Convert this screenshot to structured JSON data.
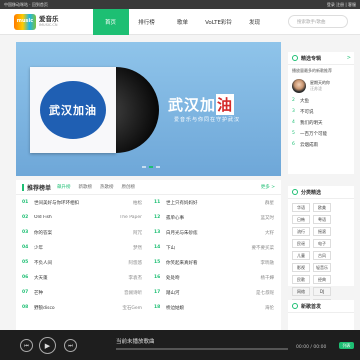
{
  "topbar": {
    "left": "中国移动咪咕 · 回到首页",
    "right": "登录 注册 | 客服"
  },
  "logo": {
    "badge": "music",
    "name": "爱音乐",
    "sub": "IMUSIC.CN"
  },
  "nav": [
    {
      "label": "首页"
    },
    {
      "label": "排行榜"
    },
    {
      "label": "歌单"
    },
    {
      "label": "VoLTE彩铃"
    },
    {
      "label": "发现"
    }
  ],
  "search": {
    "placeholder": "搜索歌手/歌曲"
  },
  "banner": {
    "cover_text": "武汉加油",
    "title": "武汉加",
    "title_box": "油",
    "subtitle": "爱音乐与你同在守护武汉"
  },
  "chart": {
    "title": "推荐榜单",
    "tabs": [
      "飙升榜",
      "新歌榜",
      "热歌榜",
      "原创榜"
    ],
    "more": "更多 >",
    "left": [
      {
        "n": "01",
        "song": "世间美好与你环环相扣",
        "artist": "柏松"
      },
      {
        "n": "02",
        "song": "Old Fish",
        "artist": "The Paper"
      },
      {
        "n": "03",
        "song": "你的答案",
        "artist": "阿冗"
      },
      {
        "n": "04",
        "song": "少年",
        "artist": "梦然"
      },
      {
        "n": "05",
        "song": "不负人间",
        "artist": "阿悠悠"
      },
      {
        "n": "06",
        "song": "大天蓬",
        "artist": "李袁杰"
      },
      {
        "n": "07",
        "song": "芒种",
        "artist": "音阙诗听"
      },
      {
        "n": "08",
        "song": "野狼disco",
        "artist": "宝石Gem"
      }
    ],
    "right": [
      {
        "n": "11",
        "song": "世上只有妈妈好",
        "artist": "群星"
      },
      {
        "n": "12",
        "song": "孤单心事",
        "artist": "蓝又时"
      },
      {
        "n": "13",
        "song": "白月光与朱砂痣",
        "artist": "大籽"
      },
      {
        "n": "14",
        "song": "下山",
        "artist": "要不要买菜"
      },
      {
        "n": "15",
        "song": "你笑起来真好看",
        "artist": "李昕融"
      },
      {
        "n": "16",
        "song": "处处吻",
        "artist": "杨千嬅"
      },
      {
        "n": "17",
        "song": "踏山河",
        "artist": "是七叔呢"
      },
      {
        "n": "18",
        "song": "桥边姑娘",
        "artist": "海伦"
      }
    ]
  },
  "hot": {
    "title": "精选专辑",
    "more": ">",
    "first": "播放量最多的新歌推荐",
    "card": {
      "name": "星期天的你",
      "artist": "汪苏泷"
    },
    "rows": [
      {
        "n": "2",
        "text": "大鱼"
      },
      {
        "n": "3",
        "text": "不可说"
      },
      {
        "n": "4",
        "text": "我们的明天"
      },
      {
        "n": "5",
        "text": "一百万个可能"
      },
      {
        "n": "6",
        "text": "云烟成雨"
      }
    ]
  },
  "cats": {
    "title": "分类精选",
    "tags": [
      "华语",
      "欧美",
      "日韩",
      "粤语",
      "流行",
      "摇滚",
      "民谣",
      "电子",
      "儿童",
      "古风",
      "影视",
      "轻音乐",
      "民歌",
      "经典",
      "网络",
      "DJ",
      "说唱",
      "器乐"
    ]
  },
  "newfeat": {
    "title": "新歌首发"
  },
  "player": {
    "title": "当前未播放歌曲",
    "time": "00:00 / 00:00",
    "list_label": "列表"
  }
}
